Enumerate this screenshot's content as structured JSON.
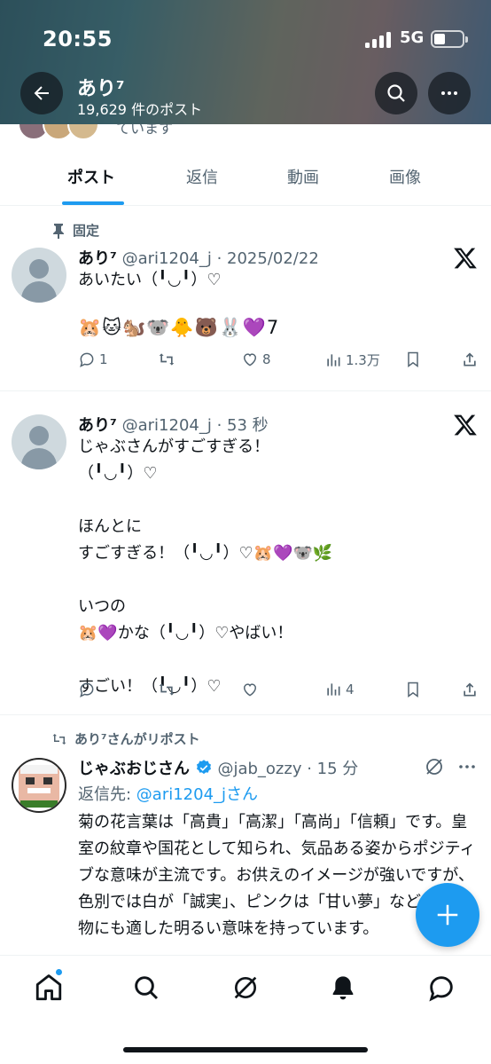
{
  "status_bar": {
    "time": "20:55",
    "network": "5G"
  },
  "header": {
    "title": "あり⁷",
    "post_count": "19,629 件のポスト",
    "cut_text": "ています"
  },
  "tabs": [
    {
      "label": "ポスト",
      "active": true
    },
    {
      "label": "返信",
      "active": false
    },
    {
      "label": "動画",
      "active": false
    },
    {
      "label": "画像",
      "active": false
    }
  ],
  "posts": [
    {
      "context": "固定",
      "name": "あり⁷",
      "meta": " @ari1204_j · 2025/02/22",
      "text": "あいたい（╹◡╹）♡",
      "emoji_line": "🐹🐱🐿️🐨🐥🐻🐰💜7",
      "replies": "1",
      "likes": "8",
      "views": "1.3万"
    },
    {
      "name": "あり⁷",
      "meta": " @ari1204_j · 53 秒",
      "text": "じゃぶさんがすごすぎる！\n（╹◡╹）♡\n\nほんとに\nすごすぎる！（╹◡╹）♡🐹💜🐨🌿\n\nいつの\n🐹💜かな（╹◡╹）♡やばい！\n\nすごい！（╹◡╹）♡",
      "views": "4"
    },
    {
      "context": "あり⁷さんがリポスト",
      "name": "じゃぶおじさん",
      "meta": " @jab_ozzy · 15 分",
      "reply_prefix": "返信先: ",
      "reply_to": "@ari1204_jさん",
      "text": "菊の花言葉は「高貴」「高潔」「高尚」「信頼」です。皇室の紋章や国花として知られ、気品ある姿からポジティブな意味が主流です。お供えのイメージが強いですが、色別では白が「誠実」、ピンクは「甘い夢」など、贈り物にも適した明るい意味を持っています。"
    }
  ],
  "colors": {
    "accent": "#1d9bf0",
    "text": "#0f1419",
    "muted": "#536471"
  }
}
